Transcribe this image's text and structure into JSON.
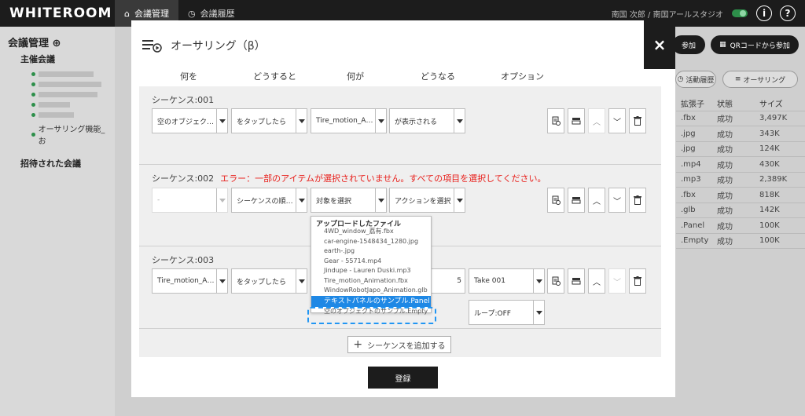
{
  "app": {
    "logo": "WHITEROOM"
  },
  "nav": {
    "tabs": [
      {
        "label": "会議管理"
      },
      {
        "label": "会議履歴"
      }
    ],
    "user": "南国 次郎 / 南国アールスタジオ"
  },
  "sidebar": {
    "title": "会議管理",
    "section_hosted": "主催会議",
    "items": [
      "オーサリング機能_お"
    ],
    "section_invited": "招待された会議"
  },
  "bg": {
    "join_label": "参加",
    "qr_label": "QRコードから参加",
    "activity_label": "活動履歴",
    "authoring_label": "オーサリング",
    "table_headers": [
      "拡張子",
      "状態",
      "サイズ"
    ],
    "rows": [
      [
        ".fbx",
        "成功",
        "3,497K"
      ],
      [
        ".jpg",
        "成功",
        "343K"
      ],
      [
        ".jpg",
        "成功",
        "124K"
      ],
      [
        ".mp4",
        "成功",
        "430K"
      ],
      [
        ".mp3",
        "成功",
        "2,389K"
      ],
      [
        ".fbx",
        "成功",
        "818K"
      ],
      [
        ".glb",
        "成功",
        "142K"
      ],
      [
        ".Panel",
        "成功",
        "100K"
      ],
      [
        ".Empty",
        "成功",
        "100K"
      ]
    ]
  },
  "modal": {
    "title": "オーサリング（β）",
    "close": "×",
    "columns": [
      "何を",
      "どうすると",
      "何が",
      "どうなる",
      "オプション"
    ],
    "sequences": [
      {
        "label": "シーケンス:001",
        "error": "",
        "what": "空のオブジェクト...",
        "how": "をタップしたら",
        "target": "Tire_motion_Anim...",
        "result": "が表示される"
      },
      {
        "label": "シーケンス:002",
        "error": "エラー：一部のアイテムが選択されていません。すべての項目を選択してください。",
        "what": "-",
        "how": "シーケンスの順番...",
        "target": "対象を選択",
        "result": "アクションを選択"
      },
      {
        "label": "シーケンス:003",
        "error": "",
        "what": "Tire_motion_Anim...",
        "how": "をタップしたら",
        "target": "5",
        "option1": "Take 001",
        "option2": "ループ:OFF"
      }
    ],
    "dropdown": {
      "heading": "アップロードしたファイル",
      "items": [
        "4WD_window_荔有.fbx",
        "car-engine-1548434_1280.jpg",
        "earth-.jpg",
        "Gear - 55714.mp4",
        "Jindupe - Lauren Duski.mp3",
        "Tire_motion_Animation.fbx",
        "WindowRobotJapo_Animation.glb",
        "テキストパネルのサンプル.Panel",
        "空のオブジェクトのサンプル.Empty"
      ]
    },
    "add_sequence": "シーケンスを追加する",
    "submit": "登録"
  },
  "colors": {
    "topbar": "#1c1c1c",
    "error": "#e8201c",
    "selection": "#1e88e5",
    "status_dot": "#2d8f4a"
  }
}
